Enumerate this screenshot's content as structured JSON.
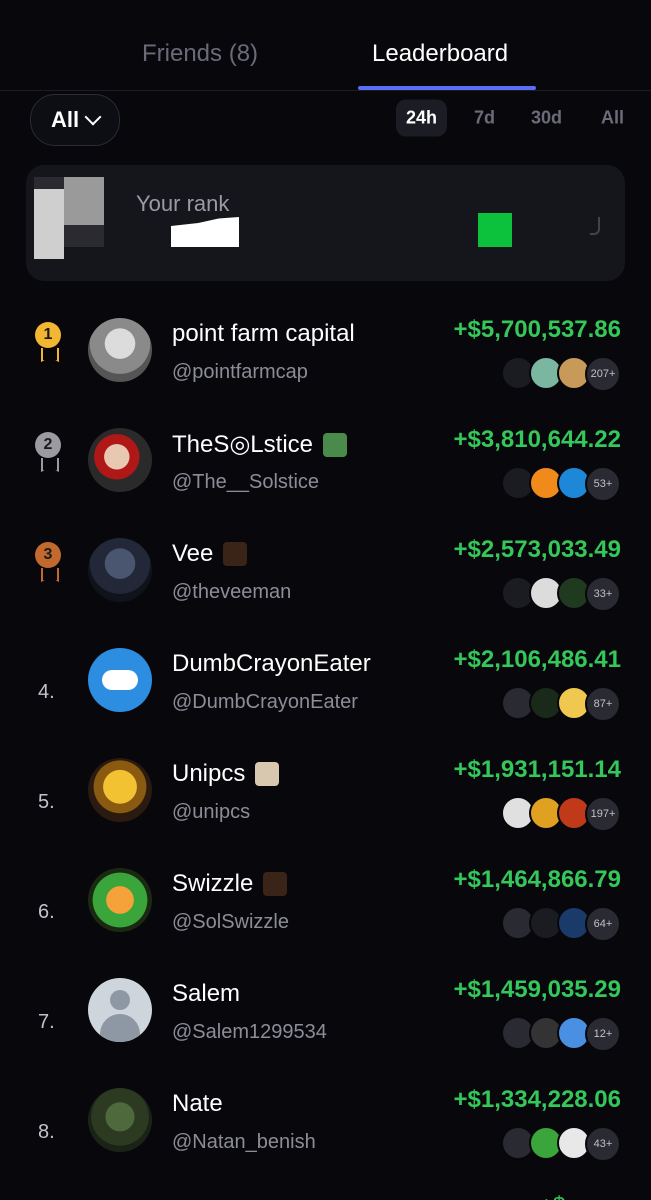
{
  "tabs": [
    {
      "label": "Friends (8)",
      "active": false
    },
    {
      "label": "Leaderboard",
      "active": true
    }
  ],
  "filter": {
    "label": "All"
  },
  "periods": [
    {
      "label": "24h",
      "active": true
    },
    {
      "label": "7d",
      "active": false
    },
    {
      "label": "30d",
      "active": false
    },
    {
      "label": "All",
      "active": false
    }
  ],
  "your_rank": {
    "label": "Your rank"
  },
  "entries": [
    {
      "rank": "1",
      "name": "point farm capital",
      "handle": "@pointfarmcap",
      "pnl": "+$5,700,537.86",
      "more": "207+",
      "medal": "gold",
      "badge": null
    },
    {
      "rank": "2",
      "name": "TheS◎Lstice",
      "handle": "@The__Solstice",
      "pnl": "+$3,810,644.22",
      "more": "53+",
      "medal": "silver",
      "badge": "green"
    },
    {
      "rank": "3",
      "name": "Vee",
      "handle": "@theveeman",
      "pnl": "+$2,573,033.49",
      "more": "33+",
      "medal": "bronze",
      "badge": "dark"
    },
    {
      "rank": "4.",
      "name": "DumbCrayonEater",
      "handle": "@DumbCrayonEater",
      "pnl": "+$2,106,486.41",
      "more": "87+",
      "medal": null,
      "badge": null
    },
    {
      "rank": "5.",
      "name": "Unipcs",
      "handle": "@unipcs",
      "pnl": "+$1,931,151.14",
      "more": "197+",
      "medal": null,
      "badge": "face"
    },
    {
      "rank": "6.",
      "name": "Swizzle",
      "handle": "@SolSwizzle",
      "pnl": "+$1,464,866.79",
      "more": "64+",
      "medal": null,
      "badge": "dark"
    },
    {
      "rank": "7.",
      "name": "Salem",
      "handle": "@Salem1299534",
      "pnl": "+$1,459,035.29",
      "more": "12+",
      "medal": null,
      "badge": null
    },
    {
      "rank": "8.",
      "name": "Nate",
      "handle": "@Natan_benish",
      "pnl": "+$1,334,228.06",
      "more": "43+",
      "medal": null,
      "badge": null
    }
  ],
  "colors": {
    "accent": "#5b6cf6",
    "positive": "#34c759",
    "gold": "#f2b632",
    "silver": "#9a9aa0",
    "bronze": "#c26a2e"
  }
}
